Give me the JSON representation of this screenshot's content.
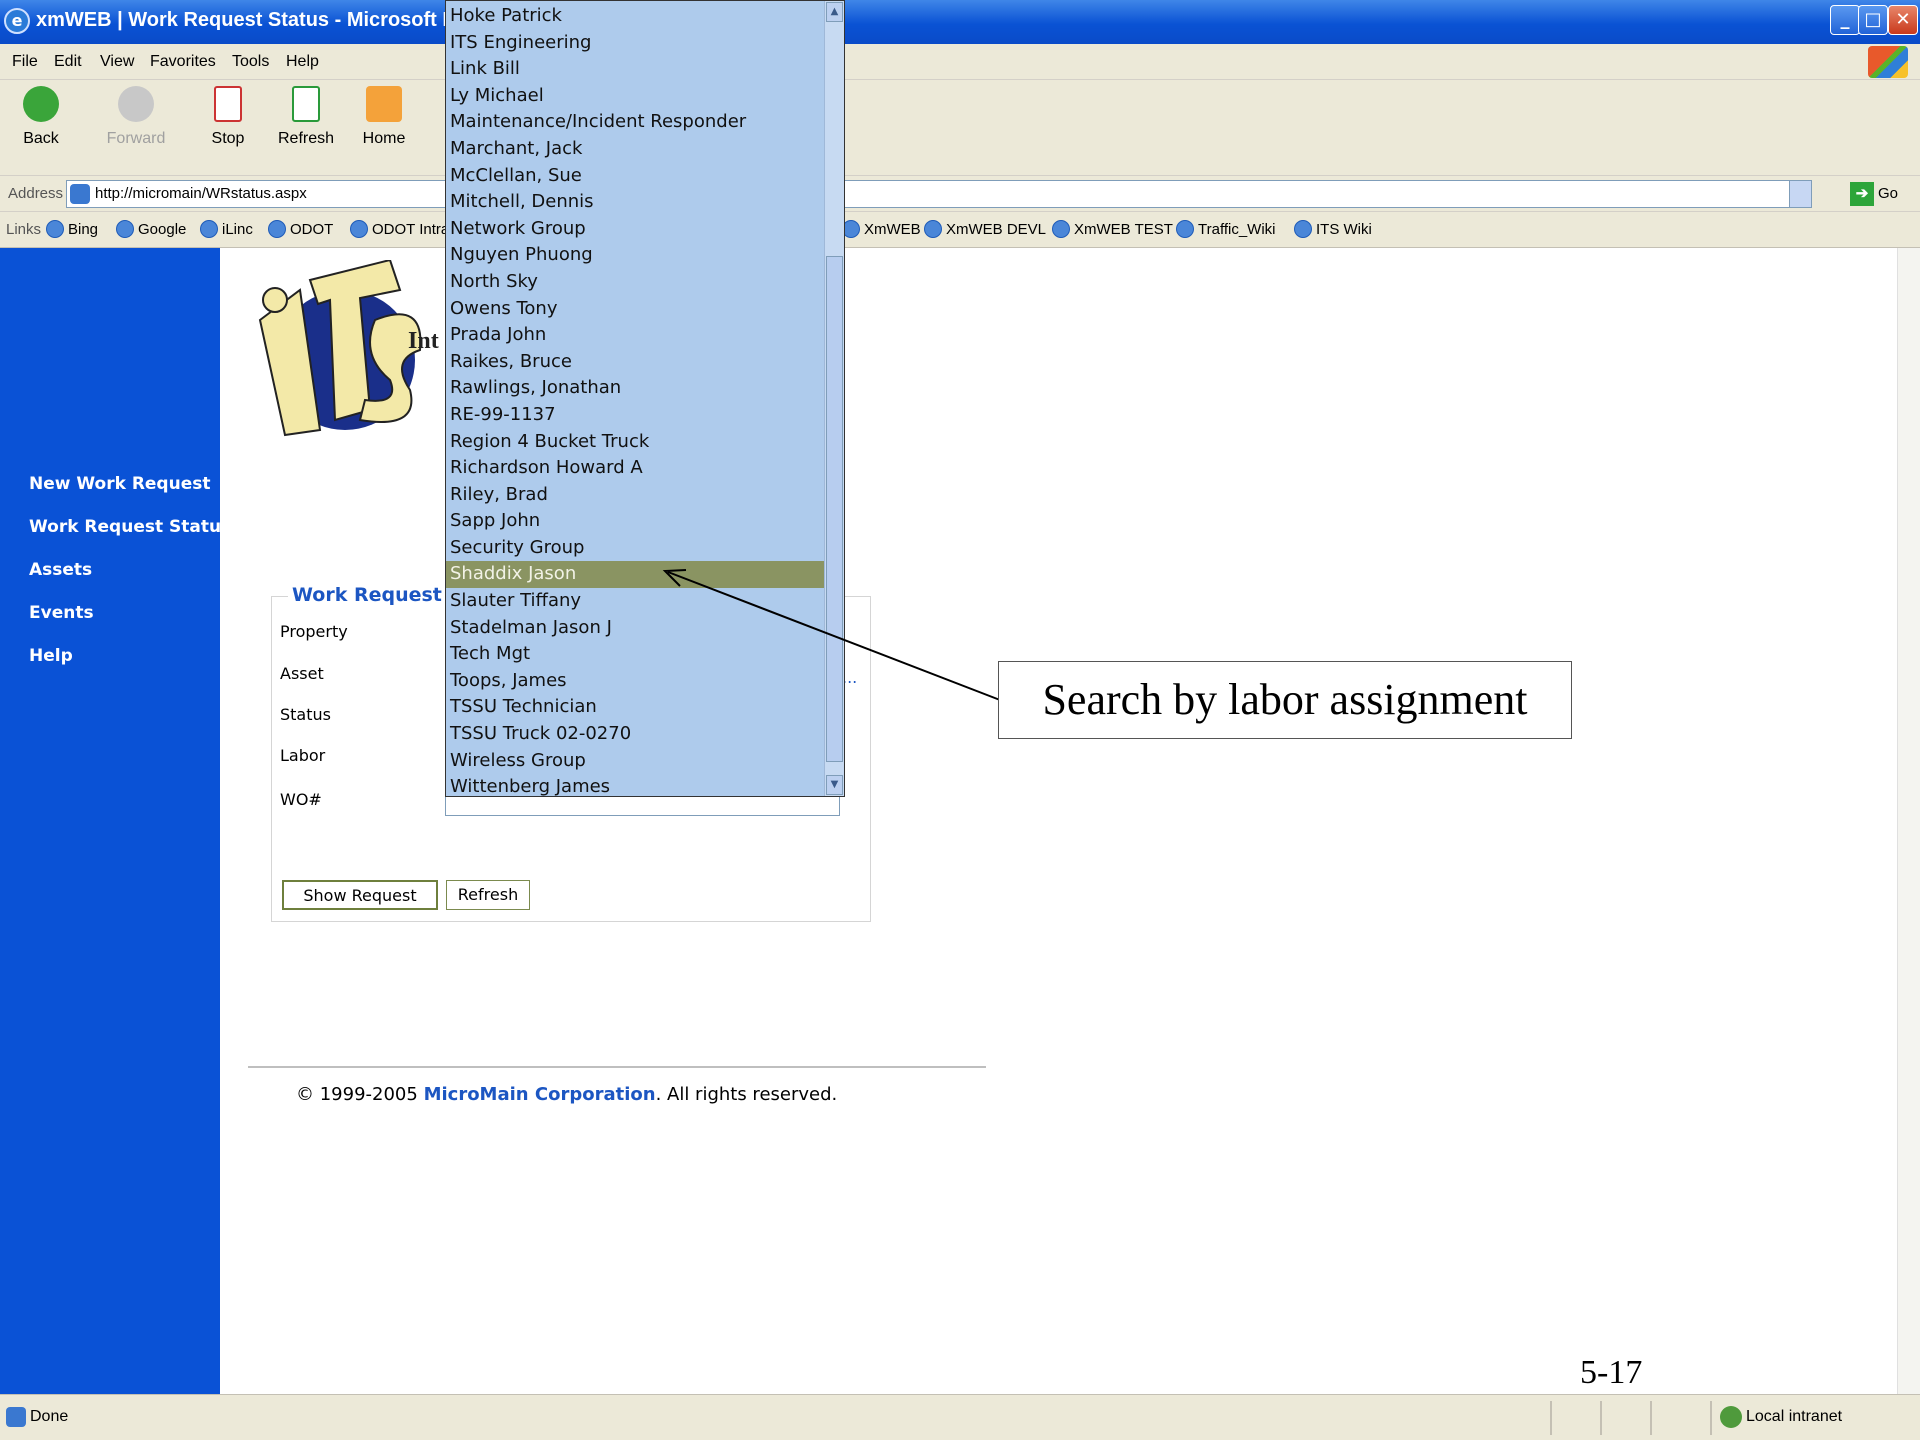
{
  "window": {
    "title": "xmWEB | Work Request Status - Microsoft Internet",
    "app_icon": "ie-icon"
  },
  "menu": [
    "File",
    "Edit",
    "View",
    "Favorites",
    "Tools",
    "Help"
  ],
  "toolbar": {
    "back": "Back",
    "forward": "Forward",
    "stop": "Stop",
    "refresh": "Refresh",
    "home": "Home"
  },
  "address": {
    "label": "Address",
    "url": "http://micromain/WRstatus.aspx",
    "go": "Go"
  },
  "links": {
    "label": "Links",
    "items_left": [
      "Bing",
      "Google",
      "iLinc",
      "ODOT",
      "ODOT Intra"
    ],
    "items_right": [
      "XmWEB",
      "XmWEB DEVL",
      "XmWEB TEST",
      "Traffic_Wiki",
      "ITS Wiki"
    ]
  },
  "sidebar": {
    "items": [
      "New Work Request",
      "Work Request Status",
      "Assets",
      "Events",
      "Help"
    ]
  },
  "logo": {
    "text": "Int"
  },
  "form": {
    "legend": "Work Request St",
    "fields": [
      "Property",
      "Asset",
      "Status",
      "Labor",
      "WO#"
    ],
    "asset_ellipsis": "...",
    "show_button": "Show Request",
    "refresh_button": "Refresh"
  },
  "labor_dropdown": {
    "options": [
      "Hoke Patrick",
      "ITS Engineering",
      "Link Bill",
      "Ly Michael",
      "Maintenance/Incident Responder",
      "Marchant, Jack",
      "McClellan, Sue",
      "Mitchell, Dennis",
      "Network Group",
      "Nguyen Phuong",
      "North Sky",
      "Owens Tony",
      "Prada John",
      "Raikes, Bruce",
      "Rawlings, Jonathan",
      "RE-99-1137",
      "Region 4 Bucket Truck",
      "Richardson Howard A",
      "Riley, Brad",
      "Sapp John",
      "Security Group",
      "Shaddix Jason",
      "Slauter Tiffany",
      "Stadelman Jason J",
      "Tech Mgt",
      "Toops, James",
      "TSSU Technician",
      "TSSU Truck 02-0270",
      "Wireless Group",
      "Wittenberg James"
    ],
    "selected": "Shaddix Jason"
  },
  "footer": {
    "copyright": "© 1999-2005 ",
    "company": "MicroMain Corporation",
    "rights": ". All rights reserved."
  },
  "callout": {
    "text": "Search by labor assignment"
  },
  "slide_number": "5-17",
  "status": {
    "text": "Done",
    "zone": "Local intranet"
  }
}
